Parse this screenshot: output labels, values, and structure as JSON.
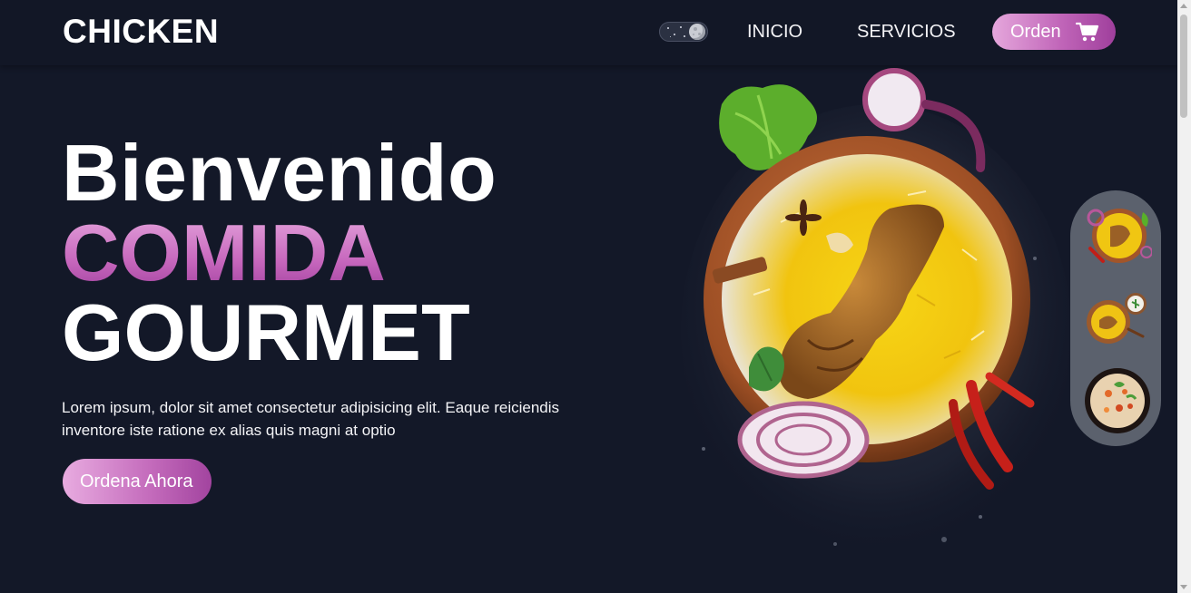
{
  "header": {
    "logo": "CHICKEN",
    "nav": [
      {
        "label": "INICIO"
      },
      {
        "label": "SERVICIOS"
      }
    ],
    "order_button": {
      "label": "Orden",
      "icon": "cart-icon"
    },
    "theme_toggle": {
      "state": "dark",
      "icon": "moon-icon"
    }
  },
  "hero": {
    "line1": "Bienvenido",
    "line2": "COMIDA",
    "line3": "GOURMET",
    "description": "Lorem ipsum, dolor sit amet consectetur adipisicing elit. Eaque reiciendis inventore iste ratione ex alias quis magni at optio",
    "cta_label": "Ordena Ahora"
  },
  "showcase": {
    "main_image": "chicken-biryani-bowl",
    "thumbnails": [
      {
        "name": "biryani-bowl-thumb"
      },
      {
        "name": "biryani-raita-thumb"
      },
      {
        "name": "fried-rice-bowl-thumb"
      }
    ]
  },
  "colors": {
    "background": "#131828",
    "accent_light": "#e5a7dc",
    "accent_dark": "#9f3f9c",
    "text": "#ffffff",
    "thumb_panel": "#5b616d"
  }
}
